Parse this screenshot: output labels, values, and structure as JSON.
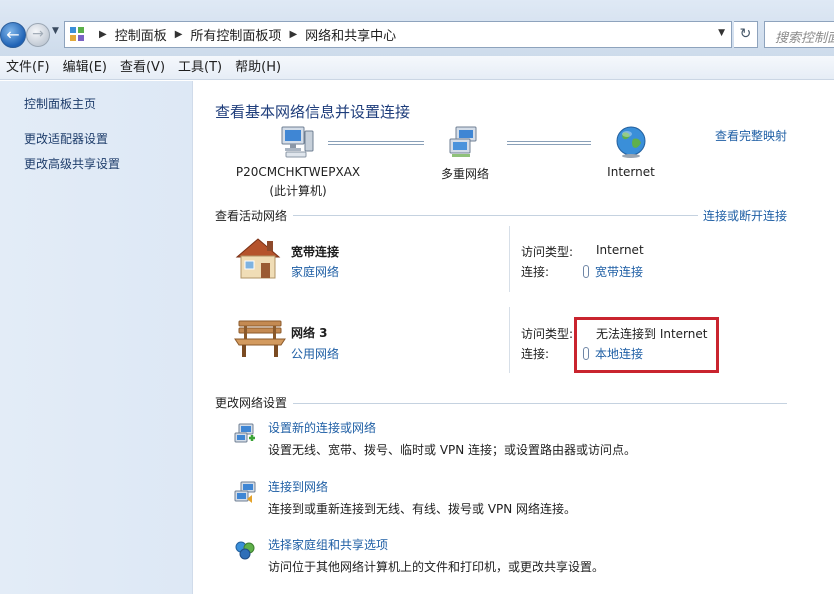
{
  "address": {
    "crumbs": [
      "控制面板",
      "所有控制面板项",
      "网络和共享中心"
    ],
    "search_placeholder": "搜索控制面板"
  },
  "menu": [
    "文件(F)",
    "编辑(E)",
    "查看(V)",
    "工具(T)",
    "帮助(H)"
  ],
  "sidebar": {
    "items": [
      "控制面板主页",
      "更改适配器设置",
      "更改高级共享设置"
    ]
  },
  "main": {
    "title": "查看基本网络信息并设置连接",
    "full_map_link": "查看完整映射",
    "map": {
      "computer_name": "P20CMCHKTWEPXAX",
      "computer_sub": "(此计算机)",
      "middle": "多重网络",
      "internet": "Internet"
    },
    "active_header": "查看活动网络",
    "connect_link": "连接或断开连接",
    "networks": [
      {
        "name": "宽带连接",
        "type": "家庭网络",
        "access_label": "访问类型:",
        "access_value": "Internet",
        "conn_label": "连接:",
        "conn_value": "宽带连接",
        "icon": "house-icon"
      },
      {
        "name": "网络  3",
        "type": "公用网络",
        "access_label": "访问类型:",
        "access_value": "无法连接到 Internet",
        "conn_label": "连接:",
        "conn_value": "本地连接",
        "icon": "bench-icon"
      }
    ],
    "change_header": "更改网络设置",
    "tasks": [
      {
        "title": "设置新的连接或网络",
        "desc": "设置无线、宽带、拨号、临时或 VPN 连接；或设置路由器或访问点。"
      },
      {
        "title": "连接到网络",
        "desc": "连接到或重新连接到无线、有线、拨号或 VPN 网络连接。"
      },
      {
        "title": "选择家庭组和共享选项",
        "desc": "访问位于其他网络计算机上的文件和打印机，或更改共享设置。"
      }
    ]
  },
  "colors": {
    "link": "#1f5fa5",
    "title": "#1e3d7b",
    "highlight": "#c9242e",
    "sidebar_bg": "#dde8f5"
  }
}
